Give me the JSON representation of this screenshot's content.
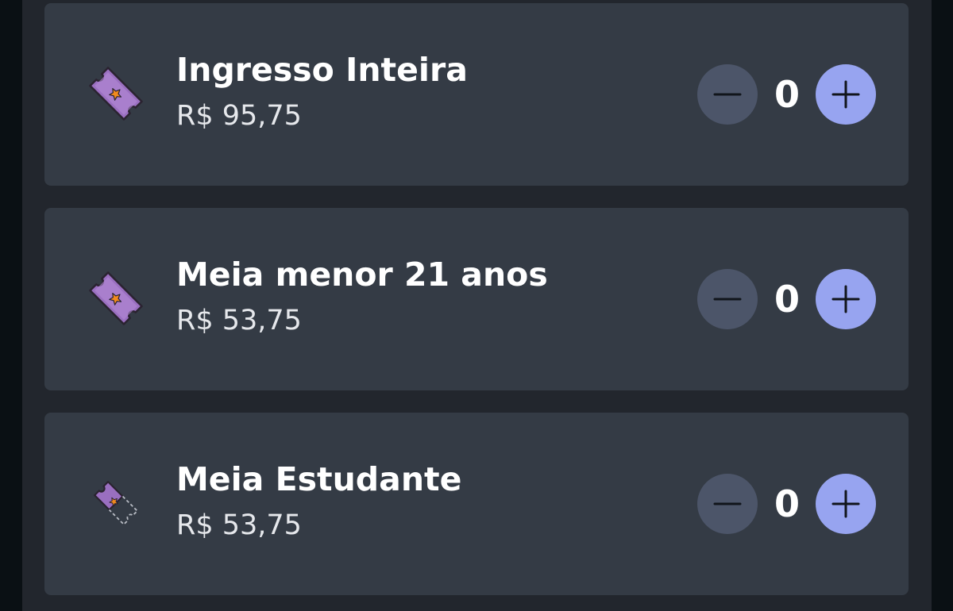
{
  "tickets": [
    {
      "name": "Ingresso Inteira",
      "price": "R$ 95,75",
      "quantity": "0",
      "icon": "ticket-icon"
    },
    {
      "name": "Meia menor 21 anos",
      "price": "R$ 53,75",
      "quantity": "0",
      "icon": "ticket-icon"
    },
    {
      "name": "Meia Estudante",
      "price": "R$ 53,75",
      "quantity": "0",
      "icon": "half-ticket-icon"
    }
  ],
  "colors": {
    "background": "#0a1014",
    "panel": "#22262d",
    "card": "#343b45",
    "minus_button": "#4c5569",
    "plus_button": "#97a4f0",
    "ticket_purple": "#9a6fc0",
    "ticket_star": "#f28a1e"
  }
}
